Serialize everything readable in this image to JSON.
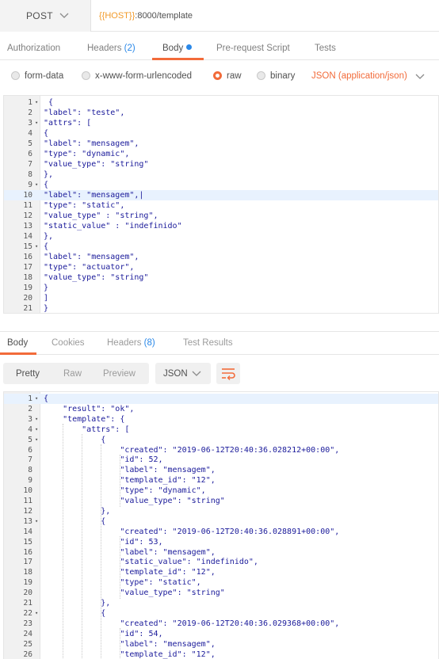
{
  "request": {
    "method": "POST",
    "url_var": "{{HOST}}",
    "url_rest": ":8000/template"
  },
  "req_tabs": {
    "authorization": "Authorization",
    "headers": "Headers",
    "headers_count": "(2)",
    "body": "Body",
    "prerequest": "Pre-request Script",
    "tests": "Tests"
  },
  "body_options": {
    "form_data": "form-data",
    "urlencoded": "x-www-form-urlencoded",
    "raw": "raw",
    "binary": "binary",
    "selected": "raw",
    "content_type": "JSON (application/json)"
  },
  "request_body": {
    "lines": [
      {
        "n": "1",
        "fold": true,
        "text": " {"
      },
      {
        "n": "2",
        "text": "\"label\": \"teste\","
      },
      {
        "n": "3",
        "fold": true,
        "text": "\"attrs\": ["
      },
      {
        "n": "4",
        "text": "{"
      },
      {
        "n": "5",
        "text": "\"label\": \"mensagem\","
      },
      {
        "n": "6",
        "text": "\"type\": \"dynamic\","
      },
      {
        "n": "7",
        "text": "\"value_type\": \"string\""
      },
      {
        "n": "8",
        "text": "},"
      },
      {
        "n": "9",
        "fold": true,
        "text": "{"
      },
      {
        "n": "10",
        "text": "\"label\": \"mensagem\",|",
        "highlight": true
      },
      {
        "n": "11",
        "text": "\"type\": \"static\","
      },
      {
        "n": "12",
        "text": "\"value_type\" : \"string\","
      },
      {
        "n": "13",
        "text": "\"static_value\" : \"indefinido\""
      },
      {
        "n": "14",
        "text": "},"
      },
      {
        "n": "15",
        "fold": true,
        "text": "{"
      },
      {
        "n": "16",
        "text": "\"label\": \"mensagem\","
      },
      {
        "n": "17",
        "text": "\"type\": \"actuator\","
      },
      {
        "n": "18",
        "text": "\"value_type\": \"string\""
      },
      {
        "n": "19",
        "text": "}"
      },
      {
        "n": "20",
        "text": "]"
      },
      {
        "n": "21",
        "text": "}"
      }
    ]
  },
  "resp_tabs": {
    "body": "Body",
    "cookies": "Cookies",
    "headers": "Headers",
    "headers_count": "(8)",
    "test_results": "Test Results"
  },
  "resp_toolbar": {
    "pretty": "Pretty",
    "raw": "Raw",
    "preview": "Preview",
    "format": "JSON"
  },
  "response_body": {
    "lines": [
      {
        "n": "1",
        "fold": true,
        "text": "{",
        "highlight": true
      },
      {
        "n": "2",
        "text": "    \"result\": \"ok\","
      },
      {
        "n": "3",
        "fold": true,
        "text": "    \"template\": {"
      },
      {
        "n": "4",
        "fold": true,
        "text": "        \"attrs\": ["
      },
      {
        "n": "5",
        "fold": true,
        "text": "            {"
      },
      {
        "n": "6",
        "text": "                \"created\": \"2019-06-12T20:40:36.028212+00:00\","
      },
      {
        "n": "7",
        "text": "                \"id\": 52,"
      },
      {
        "n": "8",
        "text": "                \"label\": \"mensagem\","
      },
      {
        "n": "9",
        "text": "                \"template_id\": \"12\","
      },
      {
        "n": "10",
        "text": "                \"type\": \"dynamic\","
      },
      {
        "n": "11",
        "text": "                \"value_type\": \"string\""
      },
      {
        "n": "12",
        "text": "            },"
      },
      {
        "n": "13",
        "fold": true,
        "text": "            {"
      },
      {
        "n": "14",
        "text": "                \"created\": \"2019-06-12T20:40:36.028891+00:00\","
      },
      {
        "n": "15",
        "text": "                \"id\": 53,"
      },
      {
        "n": "16",
        "text": "                \"label\": \"mensagem\","
      },
      {
        "n": "17",
        "text": "                \"static_value\": \"indefinido\","
      },
      {
        "n": "18",
        "text": "                \"template_id\": \"12\","
      },
      {
        "n": "19",
        "text": "                \"type\": \"static\","
      },
      {
        "n": "20",
        "text": "                \"value_type\": \"string\""
      },
      {
        "n": "21",
        "text": "            },"
      },
      {
        "n": "22",
        "fold": true,
        "text": "            {"
      },
      {
        "n": "23",
        "text": "                \"created\": \"2019-06-12T20:40:36.029368+00:00\","
      },
      {
        "n": "24",
        "text": "                \"id\": 54,"
      },
      {
        "n": "25",
        "text": "                \"label\": \"mensagem\","
      },
      {
        "n": "26",
        "text": "                \"template_id\": \"12\","
      }
    ]
  },
  "colors": {
    "accent": "#f26b3a",
    "link_blue": "#2a88e8",
    "variable_orange": "#f29b2b",
    "line_highlight": "#e8f2fe"
  },
  "icons": {
    "method_dropdown": "chevron-down-icon",
    "content_type_dropdown": "chevron-down-icon",
    "format_dropdown": "chevron-down-icon",
    "wrap": "wrap-lines-icon"
  }
}
